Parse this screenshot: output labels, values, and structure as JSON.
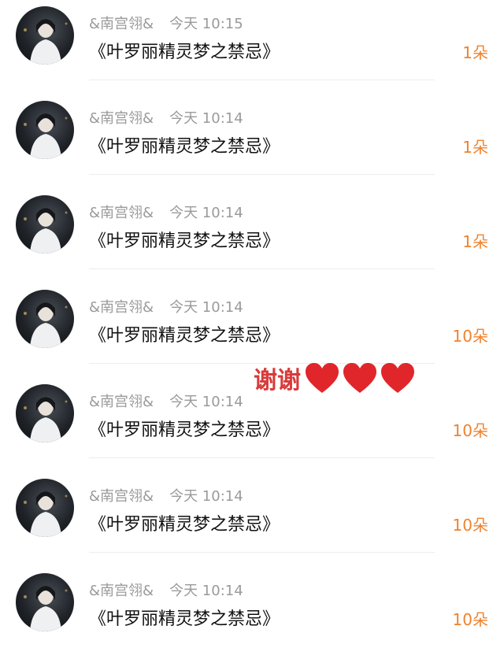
{
  "messages": [
    {
      "sender": "&南宫翎&",
      "time": "今天 10:15",
      "text": "《叶罗丽精灵梦之禁忌》",
      "count": "1朵"
    },
    {
      "sender": "&南宫翎&",
      "time": "今天 10:14",
      "text": "《叶罗丽精灵梦之禁忌》",
      "count": "1朵"
    },
    {
      "sender": "&南宫翎&",
      "time": "今天 10:14",
      "text": "《叶罗丽精灵梦之禁忌》",
      "count": "1朵"
    },
    {
      "sender": "&南宫翎&",
      "time": "今天 10:14",
      "text": "《叶罗丽精灵梦之禁忌》",
      "count": "10朵"
    },
    {
      "sender": "&南宫翎&",
      "time": "今天 10:14",
      "text": "《叶罗丽精灵梦之禁忌》",
      "count": "10朵"
    },
    {
      "sender": "&南宫翎&",
      "time": "今天 10:14",
      "text": "《叶罗丽精灵梦之禁忌》",
      "count": "10朵"
    },
    {
      "sender": "&南宫翎&",
      "time": "今天 10:14",
      "text": "《叶罗丽精灵梦之禁忌》",
      "count": "10朵"
    }
  ],
  "overlay": {
    "text": "谢谢",
    "hearts": 3,
    "heart_color": "#e0262b"
  },
  "colors": {
    "sender": "#9a9a9a",
    "title": "#111111",
    "count": "#f0822d",
    "overlay_text": "#d93a3a"
  }
}
